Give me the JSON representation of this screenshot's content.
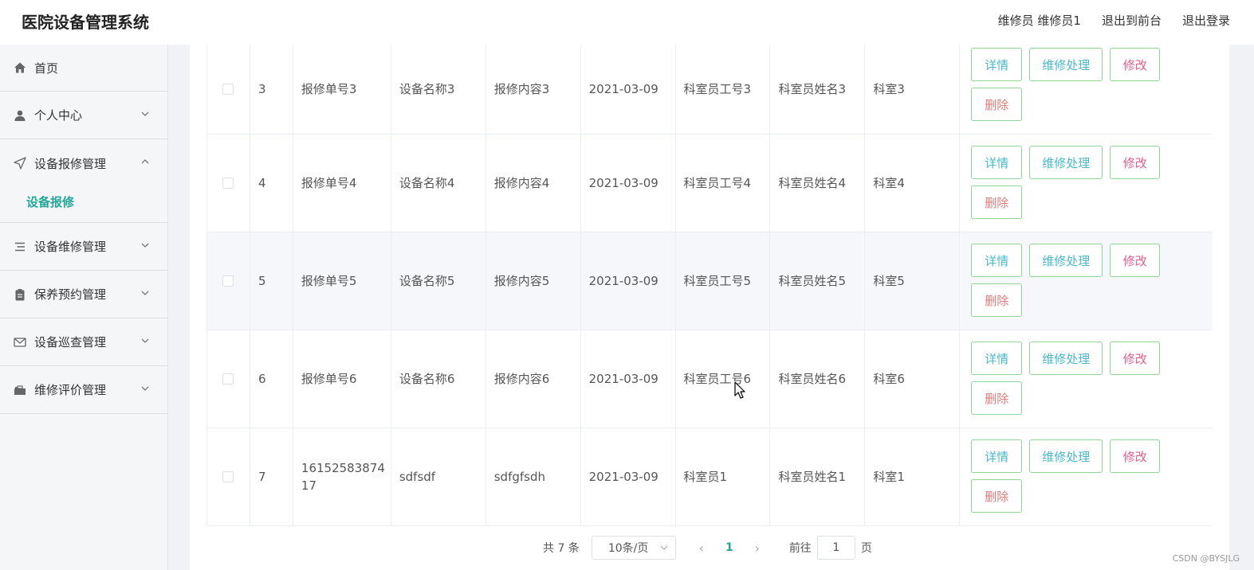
{
  "header": {
    "title": "医院设备管理系统",
    "user_label": "维修员 维修员1",
    "to_frontend": "退出到前台",
    "logout": "退出登录"
  },
  "sidebar": {
    "items": [
      {
        "label": "首页",
        "icon": "home-icon"
      },
      {
        "label": "个人中心",
        "icon": "user-icon"
      },
      {
        "label": "设备报修管理",
        "icon": "send-icon",
        "expanded": true,
        "sub": [
          "设备报修"
        ]
      },
      {
        "label": "设备维修管理",
        "icon": "list-icon"
      },
      {
        "label": "保养预约管理",
        "icon": "clipboard-icon"
      },
      {
        "label": "设备巡查管理",
        "icon": "mail-icon"
      },
      {
        "label": "维修评价管理",
        "icon": "briefcase-icon"
      }
    ]
  },
  "table": {
    "rows": [
      {
        "idx": "3",
        "no": "报修单号3",
        "name": "设备名称3",
        "content": "报修内容3",
        "date": "2021-03-09",
        "empno": "科室员工号3",
        "empname": "科室员姓名3",
        "dept": "科室3"
      },
      {
        "idx": "4",
        "no": "报修单号4",
        "name": "设备名称4",
        "content": "报修内容4",
        "date": "2021-03-09",
        "empno": "科室员工号4",
        "empname": "科室员姓名4",
        "dept": "科室4"
      },
      {
        "idx": "5",
        "no": "报修单号5",
        "name": "设备名称5",
        "content": "报修内容5",
        "date": "2021-03-09",
        "empno": "科室员工号5",
        "empname": "科室员姓名5",
        "dept": "科室5"
      },
      {
        "idx": "6",
        "no": "报修单号6",
        "name": "设备名称6",
        "content": "报修内容6",
        "date": "2021-03-09",
        "empno": "科室员工号6",
        "empname": "科室员姓名6",
        "dept": "科室6"
      },
      {
        "idx": "7",
        "no": "1615258387417",
        "name": "sdfsdf",
        "content": "sdfgfsdh",
        "date": "2021-03-09",
        "empno": "科室员1",
        "empname": "科室员姓名1",
        "dept": "科室1"
      }
    ],
    "actions": {
      "detail": "详情",
      "repair": "维修处理",
      "edit": "修改",
      "delete": "删除"
    }
  },
  "pagination": {
    "total": "共 7 条",
    "page_size": "10条/页",
    "current_page": "1",
    "goto_label": "前往",
    "goto_value": "1",
    "page_suffix": "页"
  },
  "watermark": "CSDN @BYSJLG"
}
